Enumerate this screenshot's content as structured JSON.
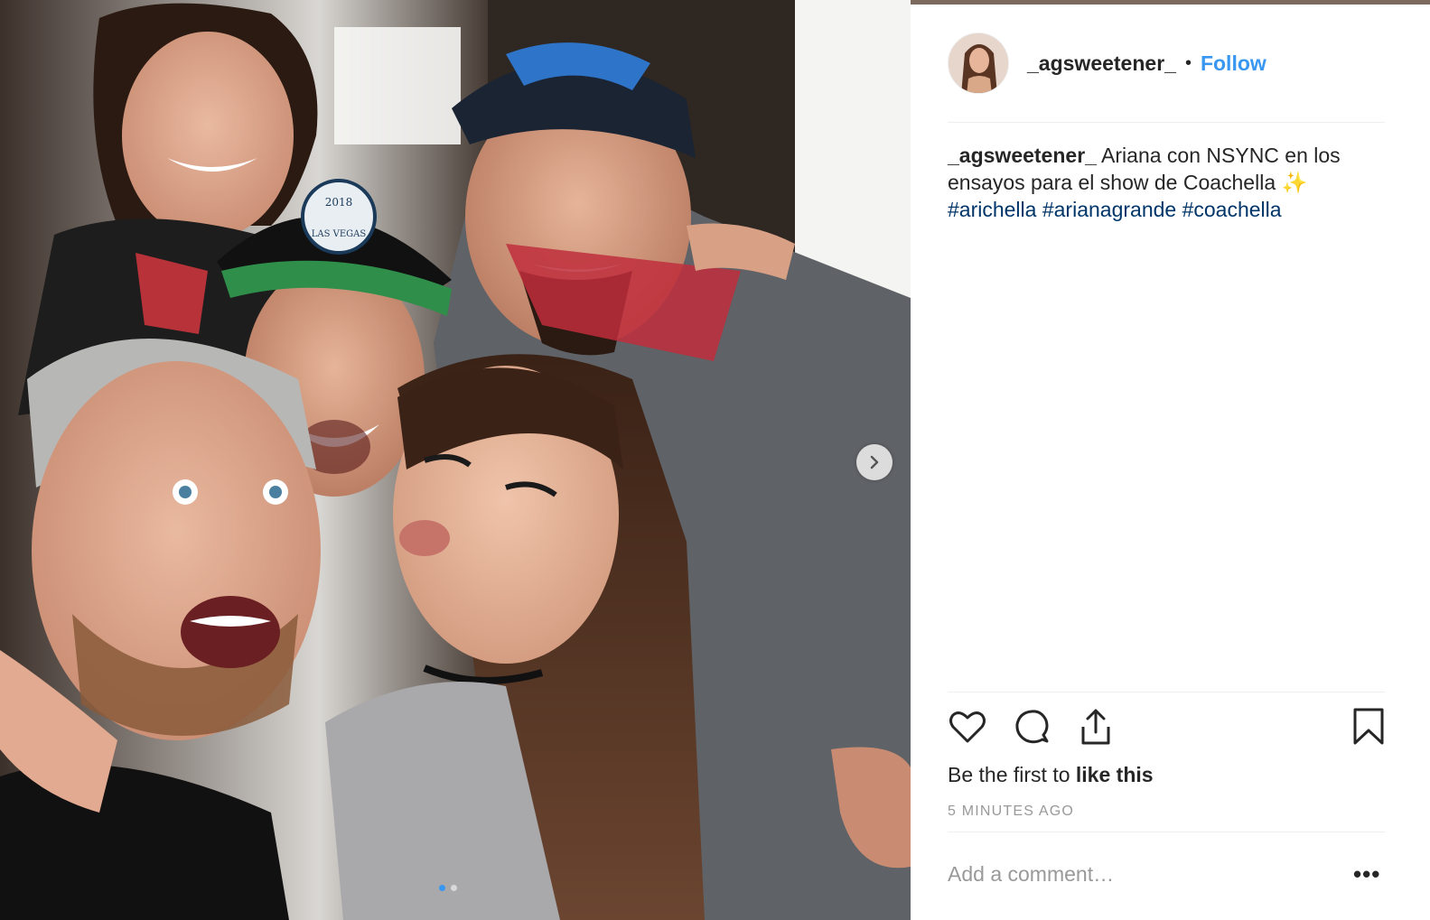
{
  "post": {
    "username": "_agsweetener_",
    "separator": "•",
    "follow_label": "Follow",
    "caption": {
      "username": "_agsweetener_",
      "text_line1": " Ariana con NSYNC en los ensayos para el show de Coachella ",
      "emoji": "✨",
      "hashtags": [
        "#arichella",
        "#arianagrande",
        "#coachella"
      ]
    },
    "likes": {
      "prefix": "Be the first to ",
      "action": "like this"
    },
    "timestamp": "5 MINUTES AGO",
    "comment_placeholder": "Add a comment…",
    "more_label": "•••"
  },
  "photo": {
    "image_count": 2,
    "current_index": 0,
    "hat_patch_text_top": "2018",
    "hat_patch_text": "LAS VEGAS"
  },
  "colors": {
    "accent": "#3897f0",
    "hashtag": "#003569",
    "text": "#262626",
    "muted": "#999999"
  },
  "icons": [
    "heart-icon",
    "comment-icon",
    "share-icon",
    "bookmark-icon",
    "chevron-right-icon"
  ]
}
